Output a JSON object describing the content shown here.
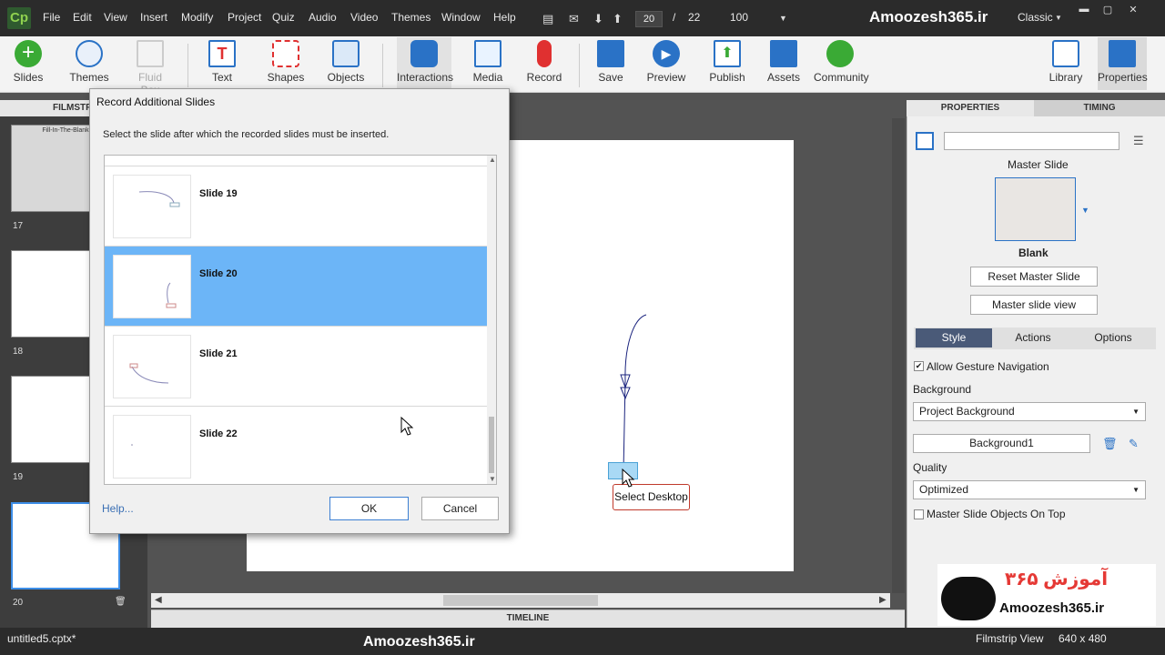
{
  "menubar": {
    "items": [
      "File",
      "Edit",
      "View",
      "Insert",
      "Modify",
      "Project",
      "Quiz",
      "Audio",
      "Video",
      "Themes",
      "Window",
      "Help"
    ],
    "slide_current": "20",
    "slide_separator": "/",
    "slide_total": "22",
    "zoom": "100",
    "brand": "Amoozesh365.ir",
    "workspace": "Classic"
  },
  "toolbar": {
    "slides": "Slides",
    "themes": "Themes",
    "fluid_box": "Fluid Box",
    "text": "Text",
    "shapes": "Shapes",
    "objects": "Objects",
    "interactions": "Interactions",
    "media": "Media",
    "record": "Record",
    "save": "Save",
    "preview": "Preview",
    "publish": "Publish",
    "assets": "Assets",
    "community": "Community",
    "library": "Library",
    "properties": "Properties"
  },
  "filmstrip": {
    "header": "FILMSTRIP",
    "first_slide_title": "Fill-In-The-Blank",
    "numbers": [
      "17",
      "18",
      "19",
      "20"
    ]
  },
  "stage": {
    "caption": "Select Desktop",
    "timeline": "TIMELINE"
  },
  "props": {
    "tab_properties": "PROPERTIES",
    "tab_timing": "TIMING",
    "master_slide": "Master Slide",
    "blank": "Blank",
    "reset": "Reset Master Slide",
    "view": "Master slide view",
    "subtab_style": "Style",
    "subtab_actions": "Actions",
    "subtab_options": "Options",
    "allow_gesture": "Allow Gesture Navigation",
    "background_label": "Background",
    "background_value": "Project Background",
    "background_name": "Background1",
    "quality_label": "Quality",
    "quality_value": "Optimized",
    "master_on_top": "Master Slide Objects On Top"
  },
  "dialog": {
    "title": "Record Additional Slides",
    "instruction": "Select the slide after which the recorded slides must be inserted.",
    "slides": [
      "Slide 19",
      "Slide 20",
      "Slide 21",
      "Slide 22"
    ],
    "selected": "Slide 20",
    "help": "Help...",
    "ok": "OK",
    "cancel": "Cancel"
  },
  "status": {
    "file": "untitled5.cptx*",
    "brand": "Amoozesh365.ir",
    "view": "Filmstrip View",
    "size": "640 x 480"
  },
  "watermark": {
    "text": "Amoozesh365.ir",
    "persian": "آموزش ۳۶۵"
  },
  "colors": {
    "accent": "#6cb5f7",
    "title_bar": "#2b2b2b",
    "caption_border": "#c0392b"
  }
}
